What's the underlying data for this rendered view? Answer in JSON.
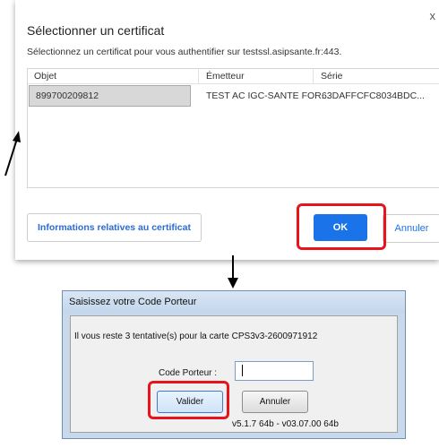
{
  "cert_dialog": {
    "title": "Sélectionner un certificat",
    "close_glyph": "x",
    "subtitle": "Sélectionnez un certificat pour vous authentifier sur testssl.asipsante.fr:443.",
    "columns": [
      "Objet",
      "Émetteur",
      "Série"
    ],
    "rows": [
      {
        "objet": "899700209812",
        "emetteur": "TEST AC IGC-SANTE FOR...",
        "serie": "63DAFFCFC8034BDC..."
      }
    ],
    "info_button": "Informations relatives au certificat",
    "ok_button": "OK",
    "cancel_button": "Annuler",
    "accent_color": "#1a73e8"
  },
  "pin_dialog": {
    "title": "Saisissez votre Code Porteur",
    "message": "Il vous reste 3 tentative(s) pour la carte CPS3v3-2600971912",
    "code_label": "Code Porteur :",
    "code_value": "",
    "validate_button": "Valider",
    "cancel_button": "Annuler",
    "version": "v5.1.7 64b - v03.07.00 64b"
  },
  "highlight_color": "#e8141b"
}
